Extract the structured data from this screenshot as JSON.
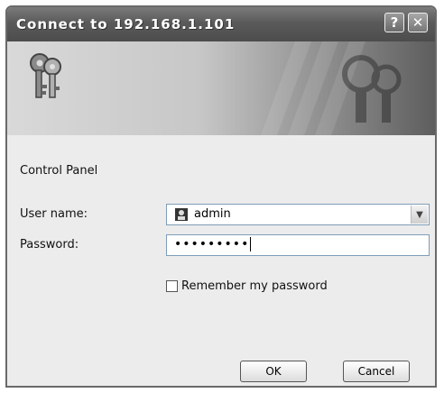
{
  "window": {
    "title": "Connect to 192.168.1.101"
  },
  "titlebar": {
    "help_label": "?",
    "close_label": "✕"
  },
  "dialog": {
    "server_text": "Control Panel",
    "username_label": "User name:",
    "username_value": "admin",
    "password_label": "Password:",
    "password_value": "•••••••••",
    "remember_label": "Remember my password",
    "remember_checked": false,
    "ok_label": "OK",
    "cancel_label": "Cancel"
  },
  "icons": {
    "banner": "keys-icon",
    "user": "user-icon",
    "dropdown": "chevron-down-icon"
  }
}
